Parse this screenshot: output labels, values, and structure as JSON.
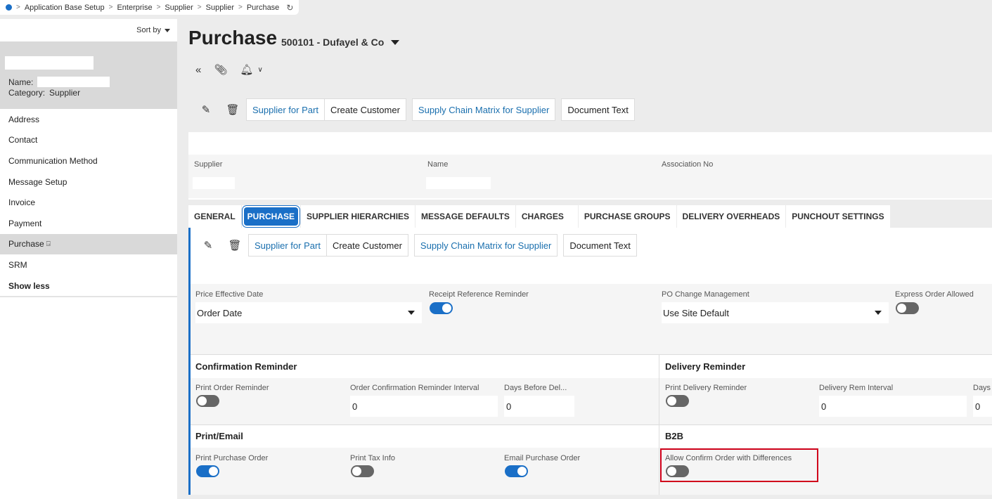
{
  "breadcrumb": {
    "items": [
      "Application Base Setup",
      "Enterprise",
      "Supplier",
      "Supplier",
      "Purchase"
    ],
    "separator": ">",
    "refresh_icon": "refresh-icon"
  },
  "sidebar": {
    "sort_label": "Sort by",
    "record": {
      "name_label": "Name:",
      "category_label": "Category:",
      "category_value": "Supplier"
    },
    "items": [
      {
        "label": "Address"
      },
      {
        "label": "Contact"
      },
      {
        "label": "Communication Method"
      },
      {
        "label": "Message Setup"
      },
      {
        "label": "Invoice"
      },
      {
        "label": "Payment"
      },
      {
        "label": "Purchase",
        "active": true
      },
      {
        "label": "SRM"
      },
      {
        "label": "Show less"
      }
    ]
  },
  "header": {
    "title": "Purchase",
    "record": "500101 - Dufayel & Co",
    "icons": [
      "collapse-icon",
      "attachment-icon",
      "bell-icon",
      "chevron-down-icon"
    ]
  },
  "commands": {
    "supplier_for_part": "Supplier for Part",
    "create_customer": "Create Customer",
    "supply_chain_matrix": "Supply Chain Matrix for Supplier",
    "document_text": "Document Text"
  },
  "header_card": {
    "supplier_label": "Supplier",
    "name_label": "Name",
    "association_label": "Association No"
  },
  "tabs": [
    "GENERAL",
    "PURCHASE",
    "SUPPLIER HIERARCHIES",
    "MESSAGE DEFAULTS",
    "CHARGES",
    "PURCHASE GROUPS",
    "DELIVERY OVERHEADS",
    "PUNCHOUT SETTINGS"
  ],
  "active_tab": "PURCHASE",
  "purchase": {
    "price_effective_date": {
      "label": "Price Effective Date",
      "value": "Order Date"
    },
    "receipt_reference_reminder": {
      "label": "Receipt Reference Reminder",
      "on": true
    },
    "po_change_management": {
      "label": "PO Change Management",
      "value": "Use Site Default"
    },
    "express_order_allowed": {
      "label": "Express Order Allowed",
      "on": false
    },
    "confirmation_reminder": {
      "title": "Confirmation Reminder",
      "print_order_reminder": {
        "label": "Print Order Reminder",
        "on": false
      },
      "order_confirmation_interval": {
        "label": "Order Confirmation Reminder Interval",
        "value": "0"
      },
      "days_before_delivery": {
        "label": "Days Before Del...",
        "value": "0"
      }
    },
    "delivery_reminder": {
      "title": "Delivery Reminder",
      "print_delivery_reminder": {
        "label": "Print Delivery Reminder",
        "on": false
      },
      "delivery_rem_interval": {
        "label": "Delivery Rem Interval",
        "value": "0"
      },
      "days": {
        "label": "Days",
        "value": "0"
      }
    },
    "print_email": {
      "title": "Print/Email",
      "print_purchase_order": {
        "label": "Print Purchase Order",
        "on": true
      },
      "print_tax_info": {
        "label": "Print Tax Info",
        "on": false
      },
      "email_purchase_order": {
        "label": "Email Purchase Order",
        "on": true
      }
    },
    "b2b": {
      "title": "B2B",
      "allow_confirm_order": {
        "label": "Allow Confirm Order with Differences",
        "on": false
      }
    }
  },
  "colors": {
    "accent": "#1a6fc7",
    "highlight": "#d0021b",
    "link": "#1a6fae"
  }
}
